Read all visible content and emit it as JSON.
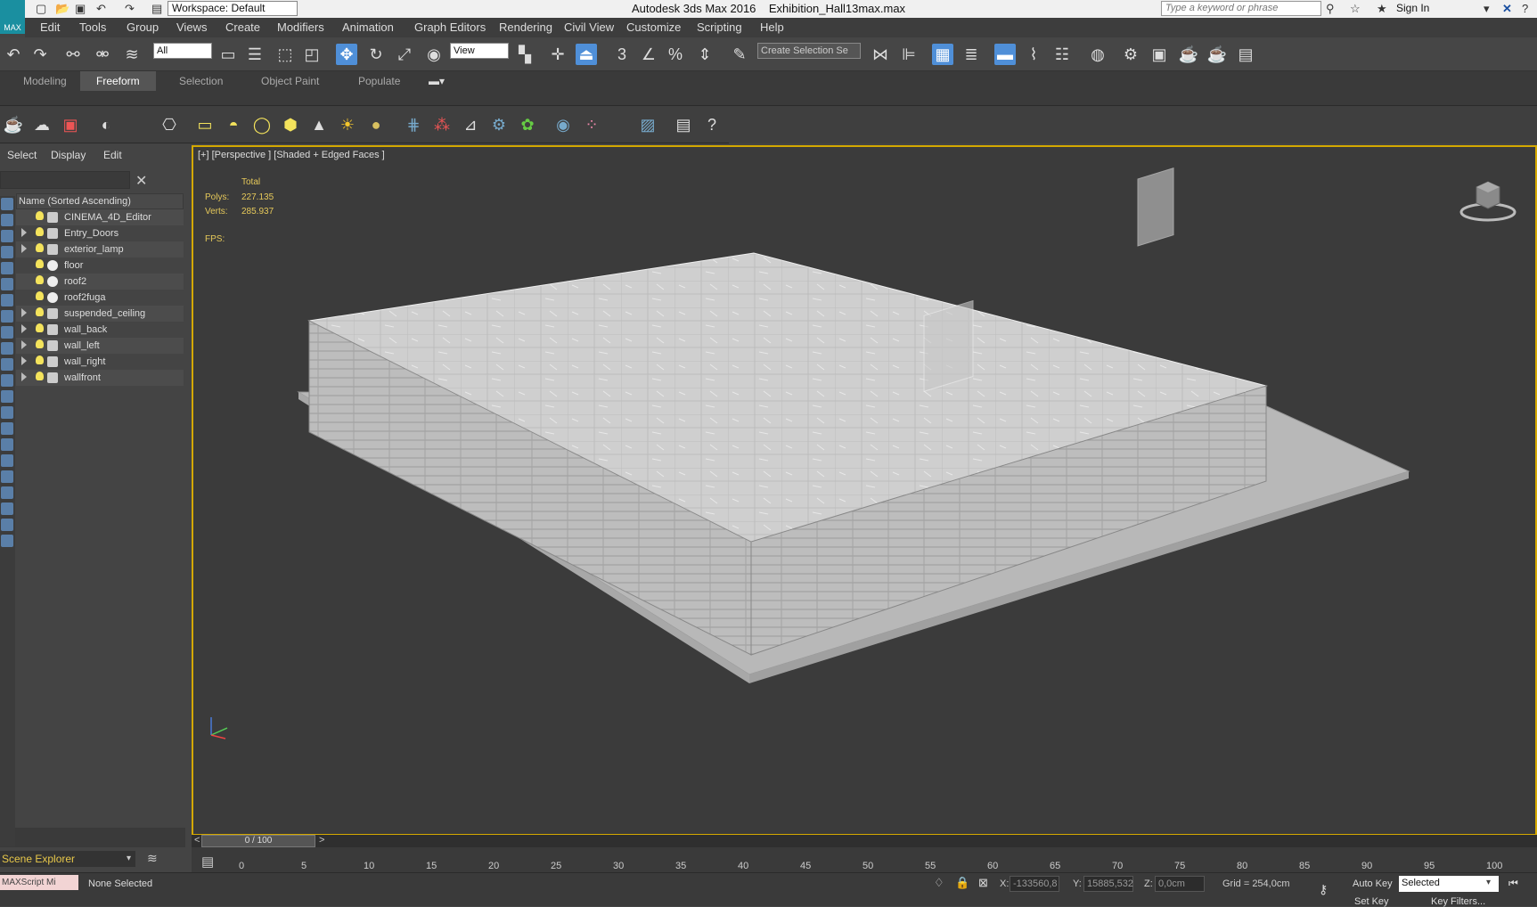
{
  "title_bar": {
    "workspace": "Workspace: Default",
    "app_title": "Autodesk 3ds Max 2016",
    "file_name": "Exhibition_Hall13max.max",
    "search_placeholder": "Type a keyword or phrase",
    "sign_in": "Sign In"
  },
  "logo_text": "MAX",
  "menu": [
    "Edit",
    "Tools",
    "Group",
    "Views",
    "Create",
    "Modifiers",
    "Animation",
    "Graph Editors",
    "Rendering",
    "Civil View",
    "Customize",
    "Scripting",
    "Help"
  ],
  "toolbar": {
    "selection_filter": "All",
    "ref_coord": "View",
    "named_selection": "Create Selection Se"
  },
  "ribbon_tabs": [
    "Modeling",
    "Freeform",
    "Selection",
    "Object Paint",
    "Populate"
  ],
  "ribbon_active": "Freeform",
  "explorer": {
    "menu": [
      "Select",
      "Display",
      "Edit"
    ],
    "column_header": "Name (Sorted Ascending)",
    "items": [
      {
        "name": "CINEMA_4D_Editor",
        "expandable": false,
        "icon": "camera-icon"
      },
      {
        "name": "Entry_Doors",
        "expandable": true,
        "icon": "group-icon"
      },
      {
        "name": "exterior_lamp",
        "expandable": true,
        "icon": "group-icon"
      },
      {
        "name": "floor",
        "expandable": false,
        "icon": "sphere-icon"
      },
      {
        "name": "roof2",
        "expandable": false,
        "icon": "sphere-icon"
      },
      {
        "name": "roof2fuga",
        "expandable": false,
        "icon": "sphere-icon"
      },
      {
        "name": "suspended_ceiling",
        "expandable": true,
        "icon": "group-icon"
      },
      {
        "name": "wall_back",
        "expandable": true,
        "icon": "group-icon"
      },
      {
        "name": "wall_left",
        "expandable": true,
        "icon": "group-icon"
      },
      {
        "name": "wall_right",
        "expandable": true,
        "icon": "group-icon"
      },
      {
        "name": "wallfront",
        "expandable": true,
        "icon": "group-icon"
      }
    ],
    "footer_title": "Scene Explorer"
  },
  "viewport": {
    "label": "[+] [Perspective ] [Shaded + Edged Faces ]",
    "stats_total": "Total",
    "polys_label": "Polys:",
    "polys_value": "227.135",
    "verts_label": "Verts:",
    "verts_value": "285.937",
    "fps_label": "FPS:"
  },
  "timeline": {
    "position": "0 / 100",
    "ticks": [
      "0",
      "5",
      "10",
      "15",
      "20",
      "25",
      "30",
      "35",
      "40",
      "45",
      "50",
      "55",
      "60",
      "65",
      "70",
      "75",
      "80",
      "85",
      "90",
      "95",
      "100"
    ]
  },
  "status": {
    "maxscript": "MAXScript Mi",
    "selection": "None Selected",
    "x_label": "X:",
    "x_value": "-133560,8",
    "y_label": "Y:",
    "y_value": "15885,532",
    "z_label": "Z:",
    "z_value": "0,0cm",
    "grid": "Grid = 254,0cm",
    "auto_key": "Auto Key",
    "key_mode": "Selected",
    "set_key": "Set Key",
    "key_filters": "Key Filters..."
  },
  "colors": {
    "viewport_border": "#d4a800",
    "active_tool": "#4f8fd8",
    "stats_text": "#e6c95a"
  }
}
